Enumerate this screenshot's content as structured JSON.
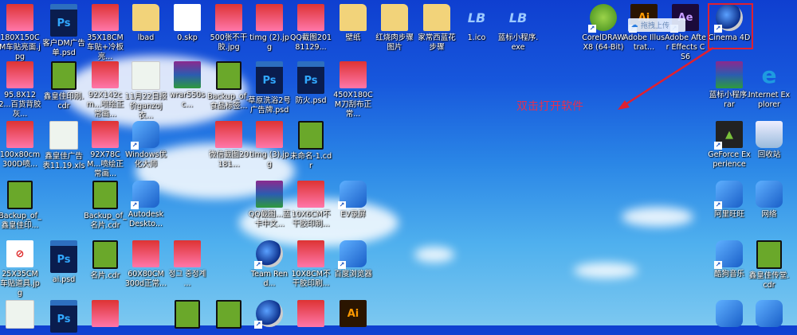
{
  "annotation": {
    "text": "双击打开软件",
    "color": "#e02030"
  },
  "tooltip": {
    "label": "拖拽上传",
    "icon": "cloud-upload-icon"
  },
  "icons": [
    {
      "label": "180X150CM车贴亮面.jpg",
      "type": "img"
    },
    {
      "label": "客户DM广告单.psd",
      "type": "psd"
    },
    {
      "label": "35X18CM车贴+冷板亮...",
      "type": "img"
    },
    {
      "label": "lbad",
      "type": "folder"
    },
    {
      "label": "0.skp",
      "type": "file"
    },
    {
      "label": "500张不干胶.jpg",
      "type": "img"
    },
    {
      "label": "timg (2).jpg",
      "type": "img"
    },
    {
      "label": "QQ截图20181129...",
      "type": "img"
    },
    {
      "label": "壁纸",
      "type": "folder"
    },
    {
      "label": "红烧肉步骤图片",
      "type": "folder"
    },
    {
      "label": "家常西蓝花步骤",
      "type": "folder"
    },
    {
      "label": "1.ico",
      "type": "logo"
    },
    {
      "label": "蓝标小程序.exe",
      "type": "logo"
    },
    {
      "label": "CorelDRAW X8 (64-Bit)",
      "type": "corel",
      "shortcut": true
    },
    {
      "label": "Adobe Illustrat...",
      "type": "ai",
      "shortcut": true
    },
    {
      "label": "Adobe After Effects CS6",
      "type": "ae",
      "shortcut": true
    },
    {
      "label": "Cinema 4D",
      "type": "c4d",
      "shortcut": true
    },
    {
      "label": "95.8X122...百货背胶灰...",
      "type": "img"
    },
    {
      "label": "鑫皇佳印刷.cdr",
      "type": "cdr"
    },
    {
      "label": "92X142cm...喷绘正常画...",
      "type": "img"
    },
    {
      "label": "11月22日报价ganzoj衣...",
      "type": "xls"
    },
    {
      "label": "wrar550sc...",
      "type": "rar"
    },
    {
      "label": "Backup_of_食品标签...",
      "type": "cdr"
    },
    {
      "label": "草原洗浴2号广告牌.psd",
      "type": "psd"
    },
    {
      "label": "防火.psd",
      "type": "psd"
    },
    {
      "label": "450X180CM刀刮布正常...",
      "type": "img"
    },
    {
      "label": "蓝标小程序.rar",
      "type": "rar"
    },
    {
      "label": "Internet Explorer",
      "type": "ie"
    },
    {
      "label": "100x80cm 300D喷...",
      "type": "img"
    },
    {
      "label": "鑫皇佳广告表11.19.xls",
      "type": "xls"
    },
    {
      "label": "92X78CM...喷绘正常画...",
      "type": "img"
    },
    {
      "label": "Windows优化大师",
      "type": "app",
      "shortcut": true
    },
    {
      "label": "微信截图20181...",
      "type": "img"
    },
    {
      "label": "timg (3).jpg",
      "type": "img"
    },
    {
      "label": "未命名-1.cdr",
      "type": "cdr"
    },
    {
      "label": "GeForce Experience",
      "type": "nv",
      "shortcut": true
    },
    {
      "label": "回收站",
      "type": "bin"
    },
    {
      "label": "Backup_of_鑫皇佳印...",
      "type": "cdr"
    },
    {
      "label": "Backup_of_名片.cdr",
      "type": "cdr"
    },
    {
      "label": "Autodesk Deskto...",
      "type": "app",
      "shortcut": true
    },
    {
      "label": "QQ截图...蓝卡中文...",
      "type": "rar"
    },
    {
      "label": "10X6CM不干胶印刷...",
      "type": "img"
    },
    {
      "label": "EV录屏",
      "type": "app",
      "shortcut": true
    },
    {
      "label": "阿里旺旺",
      "type": "app",
      "shortcut": true
    },
    {
      "label": "网络",
      "type": "app"
    },
    {
      "label": "25X35CM车贴道具.jpg",
      "type": "sign"
    },
    {
      "label": "ai.psd",
      "type": "psd"
    },
    {
      "label": "名片.cdr",
      "type": "cdr"
    },
    {
      "label": "60X80CM 300d正常...",
      "type": "img"
    },
    {
      "label": "정그 중정계 ...",
      "type": "img"
    },
    {
      "label": "Team Rend...",
      "type": "c4d",
      "shortcut": true
    },
    {
      "label": "10X8CM不干胶印刷...",
      "type": "img"
    },
    {
      "label": "百度浏览器",
      "type": "app",
      "shortcut": true
    },
    {
      "label": "酷狗音乐",
      "type": "app",
      "shortcut": true
    },
    {
      "label": "鑫皇佳传堂.cdr",
      "type": "cdr"
    },
    {
      "label": "",
      "type": "xls"
    },
    {
      "label": "",
      "type": "psd"
    },
    {
      "label": "",
      "type": "img"
    },
    {
      "label": "",
      "type": "cdr"
    },
    {
      "label": "",
      "type": "cdr"
    },
    {
      "label": "",
      "type": "c4d",
      "shortcut": true
    },
    {
      "label": "",
      "type": "img"
    },
    {
      "label": "",
      "type": "ai"
    },
    {
      "label": "",
      "type": "app"
    },
    {
      "label": "",
      "type": "app"
    }
  ]
}
